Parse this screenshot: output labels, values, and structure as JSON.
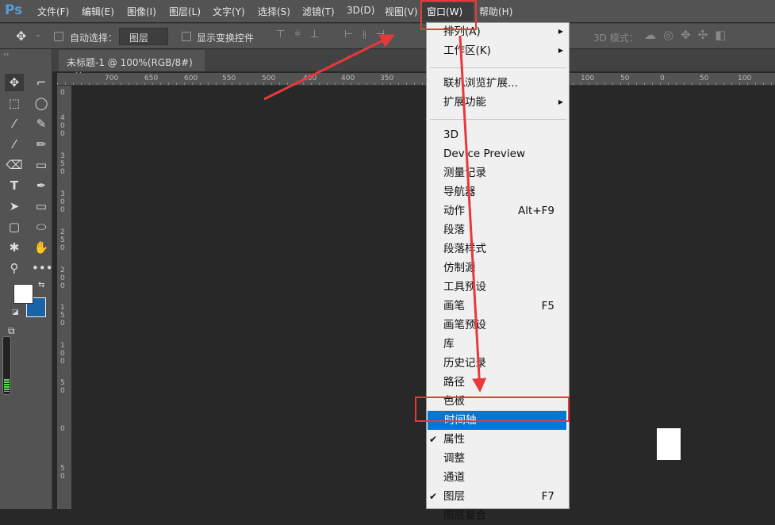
{
  "app": {
    "logo": "Ps"
  },
  "menubar": [
    "文件(F)",
    "编辑(E)",
    "图像(I)",
    "图层(L)",
    "文字(Y)",
    "选择(S)",
    "滤镜(T)",
    "3D(D)",
    "视图(V)",
    "窗口(W)",
    "帮助(H)"
  ],
  "options": {
    "auto_select_label": "自动选择：",
    "auto_select_value": "图层",
    "show_transform": "显示变换控件",
    "mode_3d": "3D 模式："
  },
  "document": {
    "tab_title": "未标题-1 @ 100%(RGB/8#)",
    "close": "×"
  },
  "rulers": {
    "horizontal": [
      "700",
      "650",
      "600",
      "550",
      "500",
      "450",
      "400",
      "350",
      "100",
      "50",
      "0",
      "50",
      "100"
    ],
    "vertical": [
      "0",
      "400",
      "350",
      "300",
      "250",
      "200",
      "150",
      "100",
      "50",
      "0",
      "50"
    ]
  },
  "colors": {
    "foreground": "#ffffff",
    "background": "#1a63a8",
    "highlight": "#0078d7",
    "annotation": "#e8393a"
  },
  "window_menu": {
    "items": [
      {
        "label": "排列(A)",
        "submenu": true
      },
      {
        "label": "工作区(K)",
        "submenu": true
      },
      {
        "separator": true
      },
      {
        "label": "联机浏览扩展..."
      },
      {
        "label": "扩展功能",
        "submenu": true
      },
      {
        "separator": true
      },
      {
        "label": "3D"
      },
      {
        "label": "Device Preview"
      },
      {
        "label": "测量记录"
      },
      {
        "label": "导航器"
      },
      {
        "label": "动作",
        "shortcut": "Alt+F9"
      },
      {
        "label": "段落"
      },
      {
        "label": "段落样式"
      },
      {
        "label": "仿制源"
      },
      {
        "label": "工具预设"
      },
      {
        "label": "画笔",
        "shortcut": "F5"
      },
      {
        "label": "画笔预设"
      },
      {
        "label": "库"
      },
      {
        "label": "历史记录"
      },
      {
        "label": "路径"
      },
      {
        "label": "色板"
      },
      {
        "label": "时间轴",
        "highlighted": true
      },
      {
        "label": "属性",
        "checked": true
      },
      {
        "label": "调整"
      },
      {
        "label": "通道"
      },
      {
        "label": "图层",
        "checked": true,
        "shortcut": "F7"
      },
      {
        "label": "图层复合"
      }
    ]
  }
}
